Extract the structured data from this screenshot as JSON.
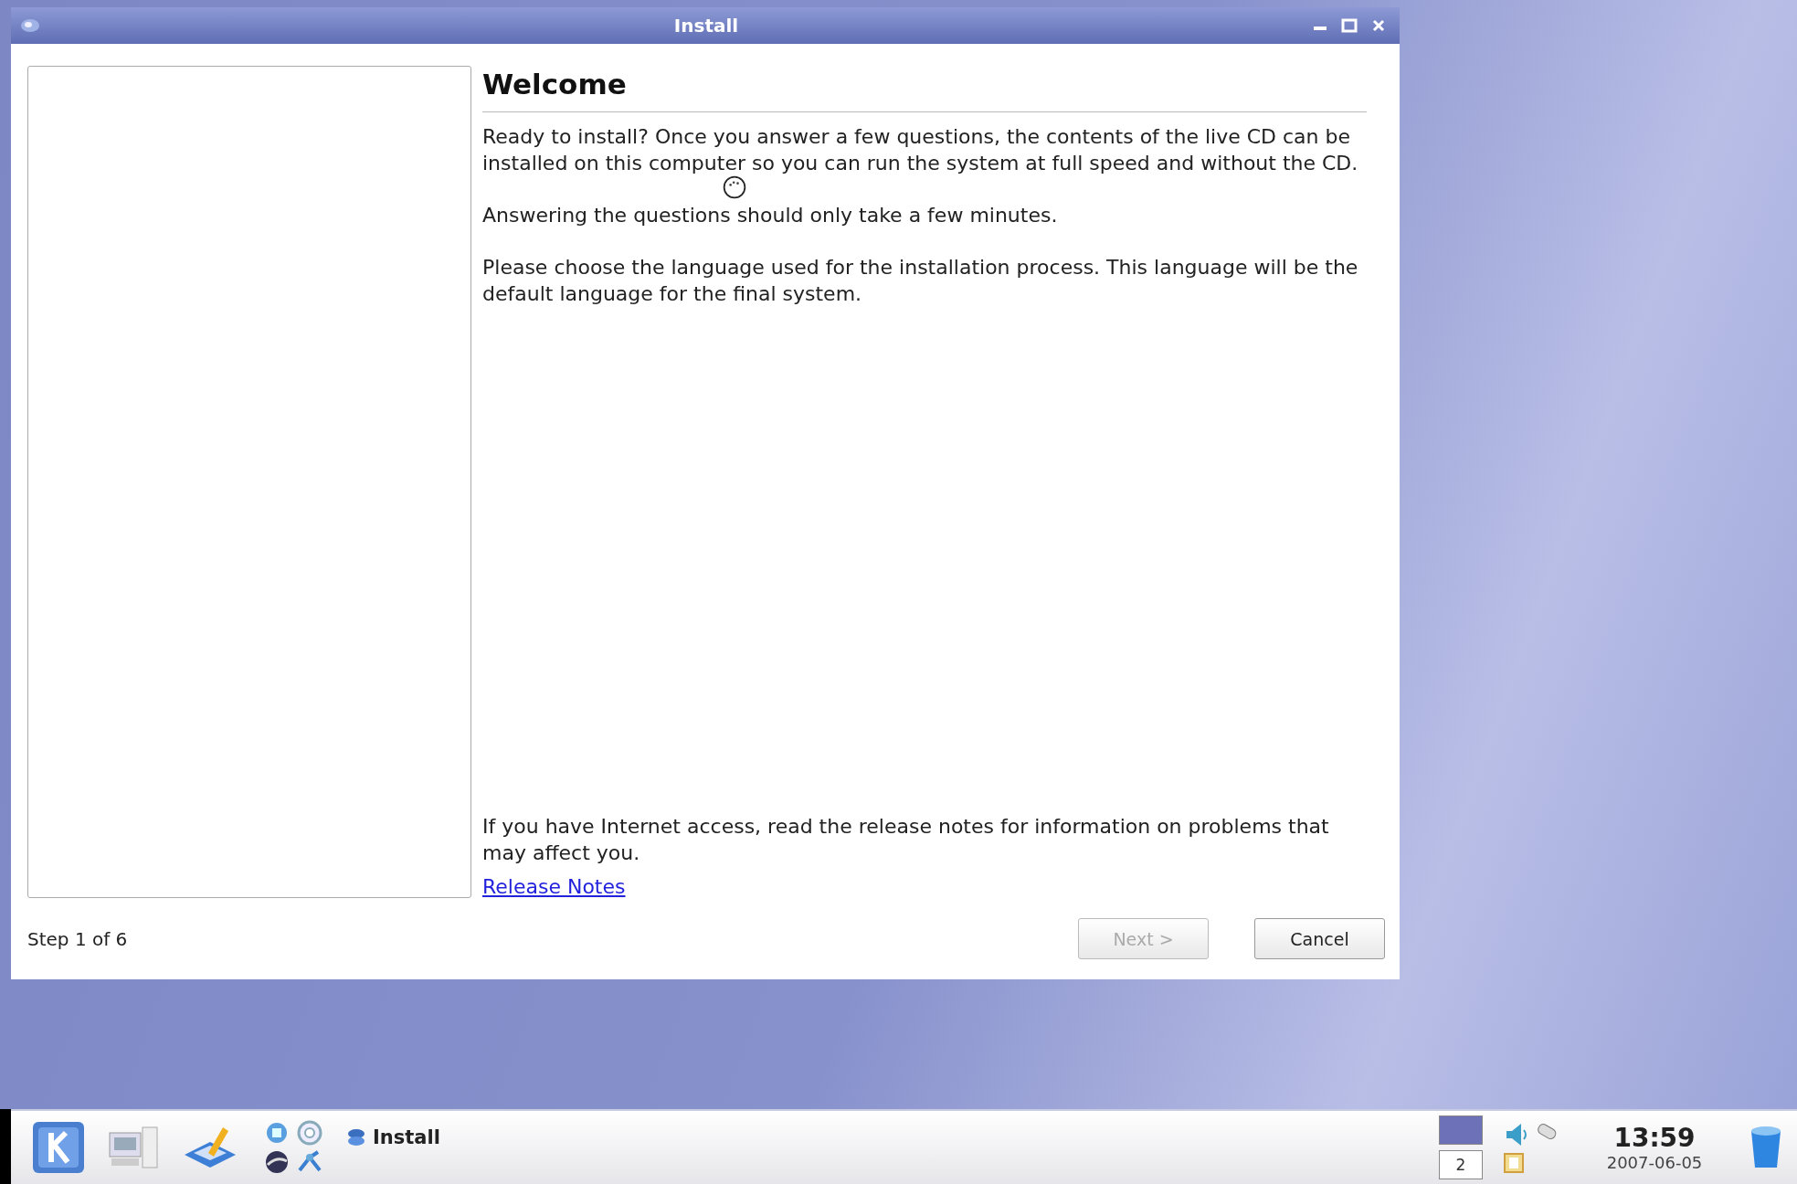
{
  "window": {
    "title": "Install"
  },
  "heading": "Welcome",
  "paragraphs": [
    "Ready to install? Once you answer a few questions, the contents of the live CD can be installed on this computer so you can run the system at full speed and without the CD.",
    "Answering the questions should only take a few minutes.",
    "Please choose the language used for the installation process. This language will be the default language for the final system."
  ],
  "notes": "If you have Internet access, read the release notes for information on problems that may affect you.",
  "release_link": "Release Notes",
  "step": "Step 1 of 6",
  "buttons": [
    {
      "label": "Next >",
      "disabled": true
    },
    {
      "label": "Cancel",
      "disabled": false
    }
  ],
  "taskbar": {
    "task": "Install",
    "pager": [
      {
        "selected": true
      },
      {
        "label": "2",
        "selected": false
      }
    ],
    "clock": "13:59",
    "date": "2007-06-05"
  }
}
